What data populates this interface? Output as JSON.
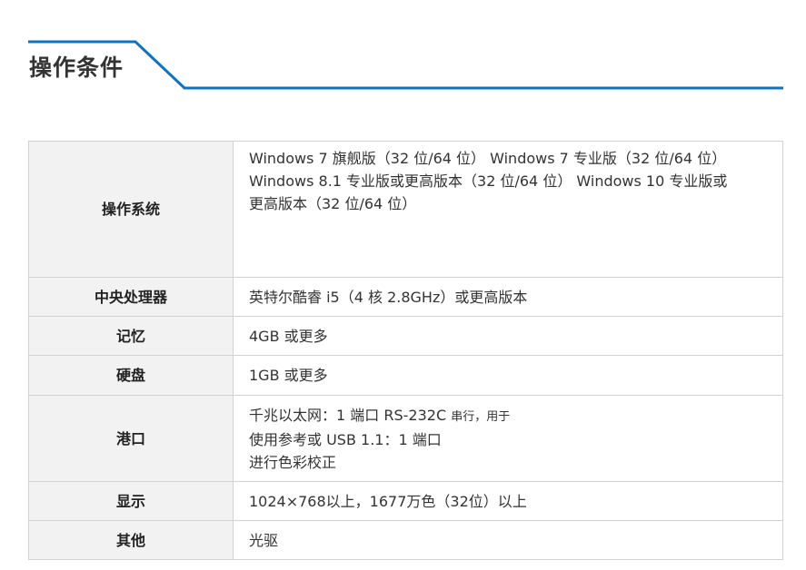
{
  "section": {
    "title": "操作条件",
    "accent_color": "#0a73c4"
  },
  "specs": [
    {
      "key": "os",
      "label": "操作系统",
      "lines": [
        "Windows 7 旗舰版（32 位/64 位） Windows 7 专业版（32 位/64 位）",
        "Windows 8.1 专业版或更高版本（32 位/64 位） Windows 10 专业版或",
        "更高版本（32 位/64 位）"
      ]
    },
    {
      "key": "cpu",
      "label": "中央处理器",
      "lines": [
        "英特尔酷睿 i5（4 核 2.8GHz）或更高版本"
      ]
    },
    {
      "key": "memory",
      "label": "记忆",
      "lines": [
        "4GB 或更多"
      ]
    },
    {
      "key": "storage",
      "label": "硬盘",
      "lines": [
        "1GB 或更多"
      ]
    },
    {
      "key": "ports",
      "label": "港口",
      "line1_main": "千兆以太网：1 端口 RS-232C ",
      "line1_small": "串行，用于",
      "line2": "使用参考或 USB 1.1：1 端口",
      "line3": "进行色彩校正"
    },
    {
      "key": "display",
      "label": "显示",
      "lines": [
        "1024×768以上，1677万色（32位）以上"
      ]
    },
    {
      "key": "other",
      "label": "其他",
      "lines": [
        "光驱"
      ]
    }
  ]
}
